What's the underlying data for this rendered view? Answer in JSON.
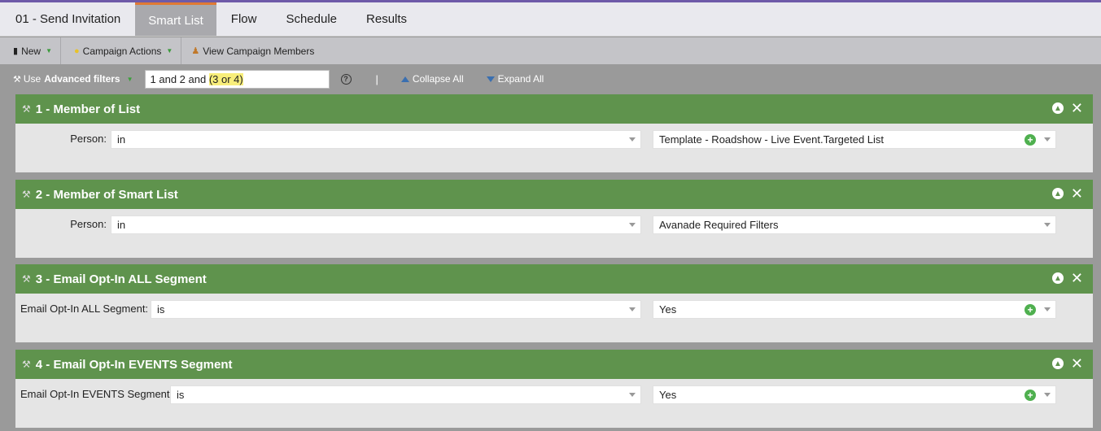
{
  "tabs": [
    {
      "label": "01 - Send Invitation"
    },
    {
      "label": "Smart List"
    },
    {
      "label": "Flow"
    },
    {
      "label": "Schedule"
    },
    {
      "label": "Results"
    }
  ],
  "toolbar": {
    "new_label": "New",
    "campaign_actions_label": "Campaign Actions",
    "view_members_label": "View Campaign Members"
  },
  "filterbar": {
    "use_label": "Use",
    "advanced_label": "Advanced filters",
    "logic_prefix": "1 and 2 and ",
    "logic_highlight": "(3 or 4)",
    "help_glyph": "?",
    "separator": "|",
    "collapse_all": "Collapse All",
    "expand_all": "Expand All"
  },
  "filters": [
    {
      "title": "1 - Member of List",
      "label": "Person:",
      "operator": "in",
      "value": "Template - Roadshow - Live Event.Targeted List",
      "has_add": true
    },
    {
      "title": "2 - Member of Smart List",
      "label": "Person:",
      "operator": "in",
      "value": "Avanade Required Filters",
      "has_add": false
    },
    {
      "title": "3 - Email Opt-In ALL Segment",
      "label": "Email Opt-In ALL Segment:",
      "operator": "is",
      "value": "Yes",
      "has_add": true
    },
    {
      "title": "4 - Email Opt-In EVENTS Segment",
      "label": "Email Opt-In EVENTS Segment:",
      "operator": "is",
      "value": "Yes",
      "has_add": true
    }
  ],
  "colors": {
    "accent_top": "#6e5aa8",
    "active_tab_border": "#e07a34",
    "filter_header": "#5f934d"
  }
}
